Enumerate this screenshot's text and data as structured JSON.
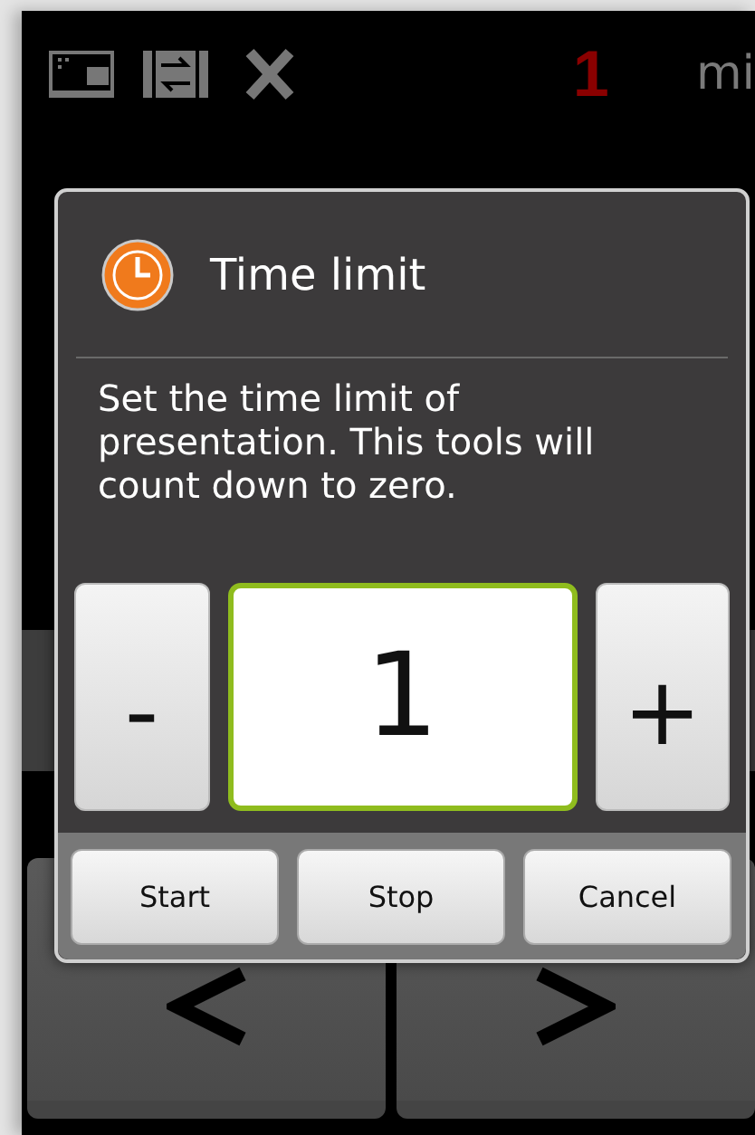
{
  "top_bar": {
    "counter": "1",
    "unit": "mi"
  },
  "dialog": {
    "title": "Time limit",
    "message": "Set the time limit of presentation. This tools will count down to zero.",
    "spinner": {
      "decrement": "-",
      "value": "1",
      "increment": "+"
    },
    "buttons": [
      {
        "label": "Start"
      },
      {
        "label": "Stop"
      },
      {
        "label": "Cancel"
      }
    ]
  }
}
